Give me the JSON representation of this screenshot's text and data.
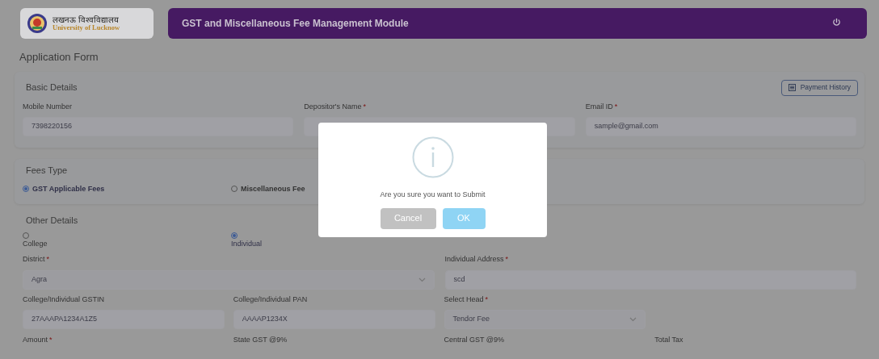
{
  "header": {
    "logo_hindi": "लखनऊ विश्वविद्यालय",
    "logo_english": "University of Lucknow",
    "title": "GST and Miscellaneous Fee Management Module"
  },
  "page_title": "Application Form",
  "basic_details": {
    "heading": "Basic Details",
    "history_button": "Payment History",
    "fields": [
      {
        "label": "Mobile Number",
        "value": "7398220156"
      },
      {
        "label": "Depositor's Name",
        "mark": "*"
      },
      {
        "label": "Email ID",
        "mark": "*",
        "placeholder": "sample@gmail.com"
      }
    ]
  },
  "fees_type": {
    "heading": "Fees Type",
    "options": [
      {
        "label": "GST Applicable Fees",
        "selected": true
      },
      {
        "label": "Miscellaneous Fee",
        "selected": false
      }
    ]
  },
  "other_details": {
    "heading": "Other Details",
    "options": [
      {
        "label": "College",
        "selected": false
      },
      {
        "label": "Individual",
        "selected": true
      }
    ],
    "row1": [
      {
        "label": "District",
        "mark": "*",
        "value": "Agra",
        "kind": "select"
      },
      {
        "label": "Individual Address",
        "mark": "*",
        "value": "scd",
        "kind": "input"
      }
    ],
    "row2": [
      {
        "label": "College/Individual GSTIN",
        "value": "27AAAPA1234A1Z5",
        "kind": "input"
      },
      {
        "label": "College/Individual PAN",
        "value": "AAAAP1234X",
        "kind": "input"
      },
      {
        "label": "Select Head",
        "mark": "*",
        "value": "Tendor Fee",
        "kind": "select"
      }
    ],
    "row3": [
      {
        "label": "Amount",
        "mark": "*"
      },
      {
        "label": "State GST @9%"
      },
      {
        "label": "Central GST @9%"
      },
      {
        "label": "Total Tax"
      }
    ]
  },
  "dialog": {
    "message": "Are you sure you want to Submit",
    "buttons": [
      {
        "label": "Cancel",
        "kind": "cancel"
      },
      {
        "label": "OK",
        "kind": "confirm"
      }
    ]
  }
}
